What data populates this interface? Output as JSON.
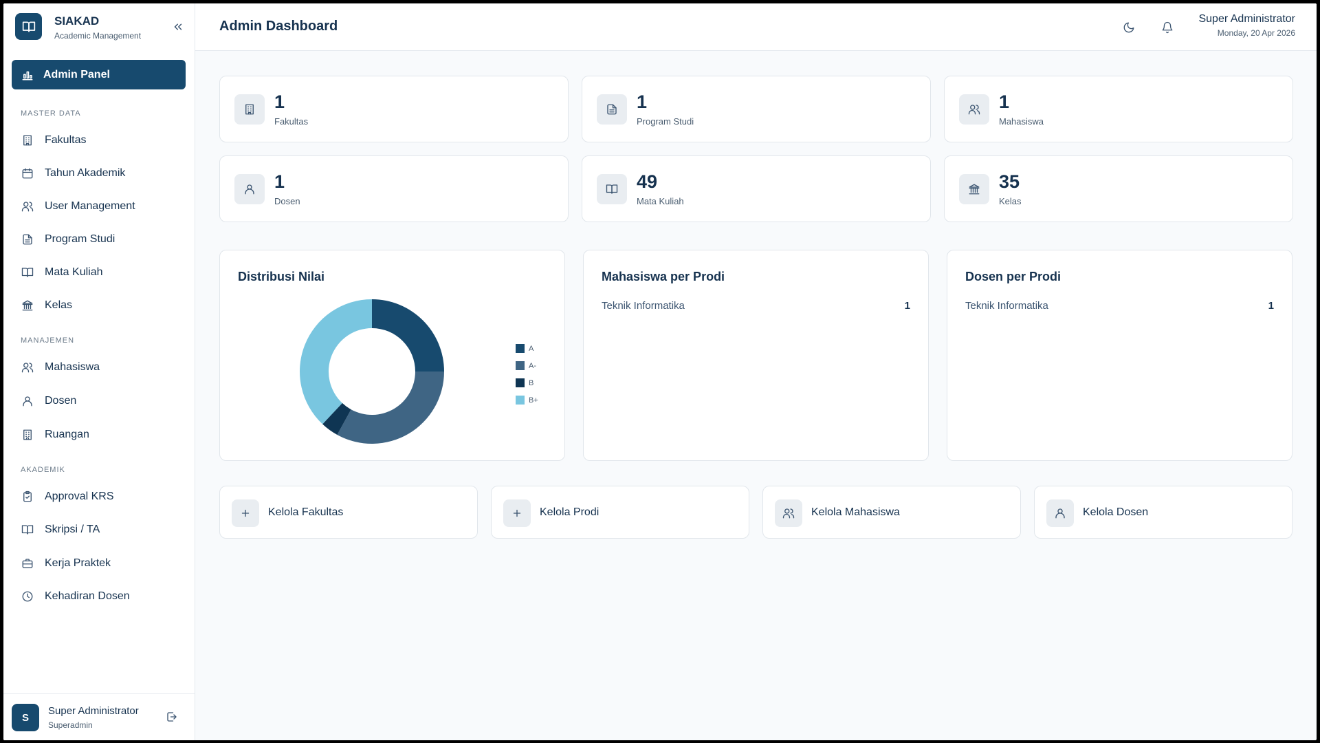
{
  "brand": {
    "name": "SIAKAD",
    "subtitle": "Academic Management"
  },
  "sidebar": {
    "active": {
      "label": "Admin Panel"
    },
    "sections": {
      "master": "MASTER DATA",
      "manajemen": "MANAJEMEN",
      "akademik": "AKADEMIK"
    },
    "items": {
      "fakultas": "Fakultas",
      "tahun": "Tahun Akademik",
      "user": "User Management",
      "prodi": "Program Studi",
      "matkul": "Mata Kuliah",
      "kelas": "Kelas",
      "mahasiswa": "Mahasiswa",
      "dosen": "Dosen",
      "ruangan": "Ruangan",
      "krs": "Approval KRS",
      "skripsi": "Skripsi / TA",
      "kp": "Kerja Praktek",
      "kehadiran": "Kehadiran Dosen"
    },
    "footer": {
      "initial": "S",
      "name": "Super Administrator",
      "role": "Superadmin"
    }
  },
  "header": {
    "title": "Admin Dashboard",
    "user": "Super Administrator",
    "date": "Monday, 20 Apr 2026"
  },
  "stats": [
    {
      "value": "1",
      "label": "Fakultas",
      "icon": "building-icon"
    },
    {
      "value": "1",
      "label": "Program Studi",
      "icon": "document-icon"
    },
    {
      "value": "1",
      "label": "Mahasiswa",
      "icon": "users-icon"
    },
    {
      "value": "1",
      "label": "Dosen",
      "icon": "user-icon"
    },
    {
      "value": "49",
      "label": "Mata Kuliah",
      "icon": "book-icon"
    },
    {
      "value": "35",
      "label": "Kelas",
      "icon": "bank-icon"
    }
  ],
  "distribusi": {
    "title": "Distribusi Nilai",
    "chart_data": {
      "type": "pie",
      "categories": [
        "A",
        "A-",
        "B",
        "B+"
      ],
      "values": [
        25,
        33,
        4,
        38
      ],
      "colors": [
        "#174a6e",
        "#3f6584",
        "#0f3553",
        "#79c6e0"
      ],
      "legend": "right"
    }
  },
  "mahasiswa_prodi": {
    "title": "Mahasiswa per Prodi",
    "rows": [
      {
        "name": "Teknik Informatika",
        "count": "1"
      }
    ]
  },
  "dosen_prodi": {
    "title": "Dosen per Prodi",
    "rows": [
      {
        "name": "Teknik Informatika",
        "count": "1"
      }
    ]
  },
  "quick_actions": [
    {
      "label": "Kelola Fakultas",
      "icon": "plus-icon"
    },
    {
      "label": "Kelola Prodi",
      "icon": "plus-icon"
    },
    {
      "label": "Kelola Mahasiswa",
      "icon": "users-icon"
    },
    {
      "label": "Kelola Dosen",
      "icon": "user-icon"
    }
  ]
}
